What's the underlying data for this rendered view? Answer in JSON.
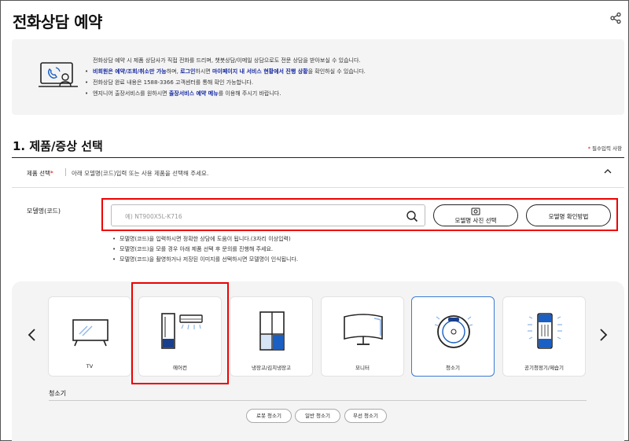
{
  "header": {
    "title": "전화상담 예약",
    "share_icon": "share-icon"
  },
  "info": {
    "lines": [
      {
        "parts": [
          {
            "text": "전화상담 예약 시 제품 상담사가 직접 전화를 드리며, 챗봇상담/이메일 상담으로도 전문 상담을 받아보실 수 있습니다.",
            "hl": false
          }
        ],
        "bullet": false
      },
      {
        "parts": [
          {
            "text": "비회원은 예약/조회/취소만 가능",
            "hl": true
          },
          {
            "text": "하며, ",
            "hl": false
          },
          {
            "text": "로그인",
            "hl": true
          },
          {
            "text": "하시면 ",
            "hl": false
          },
          {
            "text": "마이페이지 내 서비스 현황에서 진행 상황",
            "hl": true
          },
          {
            "text": "을 확인하실 수 있습니다.",
            "hl": false
          }
        ],
        "bullet": true
      },
      {
        "parts": [
          {
            "text": "전화상담 완료 내용은 1588-3366 고객센터를 통해 확인 가능합니다.",
            "hl": false
          }
        ],
        "bullet": true
      },
      {
        "parts": [
          {
            "text": "엔지니어 출장서비스를 원하시면 ",
            "hl": false
          },
          {
            "text": "출장서비스 예약 메뉴",
            "hl": true
          },
          {
            "text": "를 이용해 주시기 바랍니다.",
            "hl": false
          }
        ],
        "bullet": true
      }
    ]
  },
  "section": {
    "title": "1. 제품/증상 선택",
    "required_star": "*",
    "required_note": "필수입력 사항"
  },
  "product_select": {
    "label": "제품 선택",
    "star": "*",
    "guide": "아래 모델명(코드)입력 또는 사용 제품을 선택해 주세요."
  },
  "model": {
    "label": "모델명(코드)",
    "placeholder": "예) NT900X5L-K716",
    "photo_button": "모델명 사진 선택",
    "guide_button": "모델명 확인방법"
  },
  "notes": [
    "모델명(코드)을 입력하시면 정확한 상담에 도움이 됩니다.(3자리 이상입력)",
    "모델명(코드)을 모를 경우 아래 제품 선택 후 문의를 진행해 주세요.",
    "모델명(코드)을 촬영하거나 저장된 이미지를 선택하시면 모델명이 인식됩니다."
  ],
  "categories": [
    {
      "label": "TV",
      "icon": "tv-icon",
      "selected": false
    },
    {
      "label": "에어컨",
      "icon": "air-conditioner-icon",
      "selected": false
    },
    {
      "label": "냉장고/김치냉장고",
      "icon": "refrigerator-icon",
      "selected": false
    },
    {
      "label": "모니터",
      "icon": "monitor-icon",
      "selected": false
    },
    {
      "label": "청소기",
      "icon": "robot-vacuum-icon",
      "selected": true
    },
    {
      "label": "공기청정기/제습기",
      "icon": "air-purifier-icon",
      "selected": false
    }
  ],
  "subcategory": {
    "title": "청소기",
    "chips": [
      "로봇 청소기",
      "일반 청소기",
      "무선 청소기"
    ]
  },
  "colors": {
    "accent": "#1428a0",
    "highlight_red": "#e00000",
    "selected_border": "#3a7bd5"
  }
}
